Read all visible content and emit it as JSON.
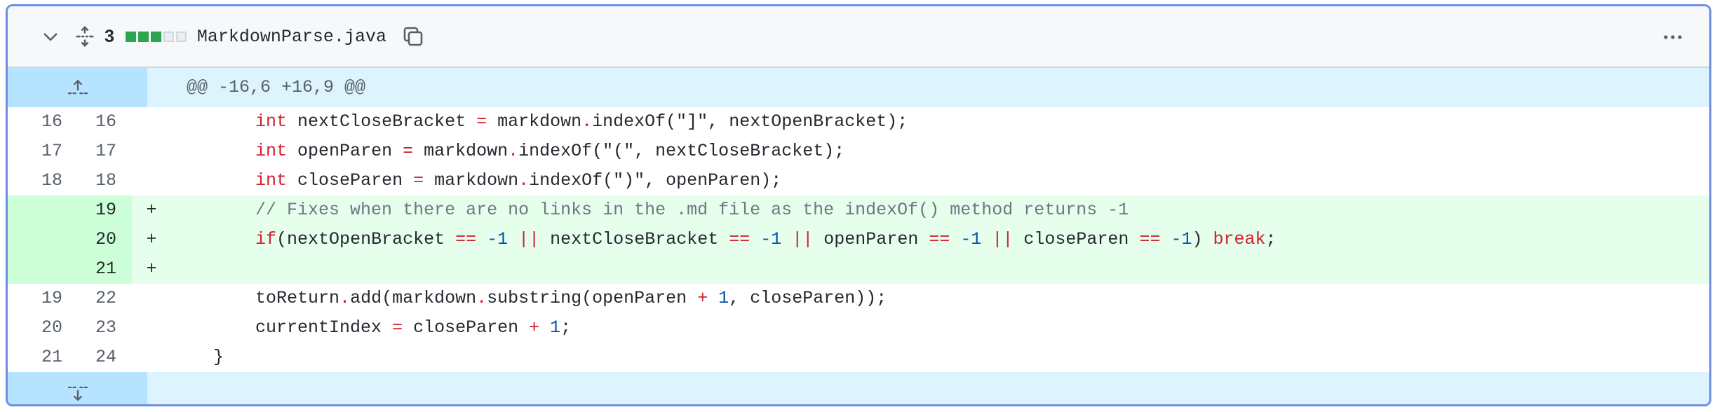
{
  "file": {
    "changes": "3",
    "name": "MarkdownParse.java",
    "colors": {
      "accent_border": "#6e8ee0",
      "added": "#2da44e",
      "hunk_bg": "#ddf4ff"
    }
  },
  "hunk": {
    "header": "@@ -16,6 +16,9 @@"
  },
  "lines": [
    {
      "old": "16",
      "new": "16",
      "marker": "",
      "type": "context"
    },
    {
      "old": "17",
      "new": "17",
      "marker": "",
      "type": "context"
    },
    {
      "old": "18",
      "new": "18",
      "marker": "",
      "type": "context"
    },
    {
      "old": "",
      "new": "19",
      "marker": "+",
      "type": "add"
    },
    {
      "old": "",
      "new": "20",
      "marker": "+",
      "type": "add"
    },
    {
      "old": "",
      "new": "21",
      "marker": "+",
      "type": "add"
    },
    {
      "old": "19",
      "new": "22",
      "marker": "",
      "type": "context"
    },
    {
      "old": "20",
      "new": "23",
      "marker": "",
      "type": "context"
    },
    {
      "old": "21",
      "new": "24",
      "marker": "",
      "type": "context"
    }
  ],
  "code": {
    "l16": {
      "indent": "        ",
      "kw": "int",
      "a": " nextCloseBracket ",
      "eq": "=",
      "b": " markdown",
      "dot": ".",
      "c": "indexOf(\"]\", nextOpenBracket);"
    },
    "l17": {
      "indent": "        ",
      "kw": "int",
      "a": " openParen ",
      "eq": "=",
      "b": " markdown",
      "dot": ".",
      "c": "indexOf(\"(\", nextCloseBracket);"
    },
    "l18": {
      "indent": "        ",
      "kw": "int",
      "a": " closeParen ",
      "eq": "=",
      "b": " markdown",
      "dot": ".",
      "c": "indexOf(\")\", openParen);"
    },
    "l19": {
      "indent": "        ",
      "comment": "// Fixes when there are no links in the .md file as the indexOf() method returns -1"
    },
    "l20": {
      "indent": "        ",
      "kw": "if",
      "p1": "(nextOpenBracket ",
      "eq1": "==",
      "sp1": " ",
      "n1": "-1",
      "sp2": " ",
      "or1": "||",
      "p2": " nextCloseBracket ",
      "eq2": "==",
      "sp3": " ",
      "n2": "-1",
      "sp4": " ",
      "or2": "||",
      "p3": " openParen ",
      "eq3": "==",
      "sp5": " ",
      "n3": "-1",
      "sp6": " ",
      "or3": "||",
      "p4": " closeParen ",
      "eq4": "==",
      "sp7": " ",
      "n4": "-1",
      "p5": ") ",
      "brk": "break",
      "semi": ";"
    },
    "l22": {
      "indent": "        ",
      "a": "toReturn",
      "dot": ".",
      "b": "add(markdown",
      "dot2": ".",
      "c": "substring(openParen ",
      "plus": "+",
      "sp": " ",
      "n": "1",
      "d": ", closeParen));"
    },
    "l23": {
      "indent": "        ",
      "a": "currentIndex ",
      "eq": "=",
      "b": " closeParen ",
      "plus": "+",
      "sp": " ",
      "n": "1",
      "c": ";"
    },
    "l24": {
      "indent": "    ",
      "a": "}"
    }
  }
}
